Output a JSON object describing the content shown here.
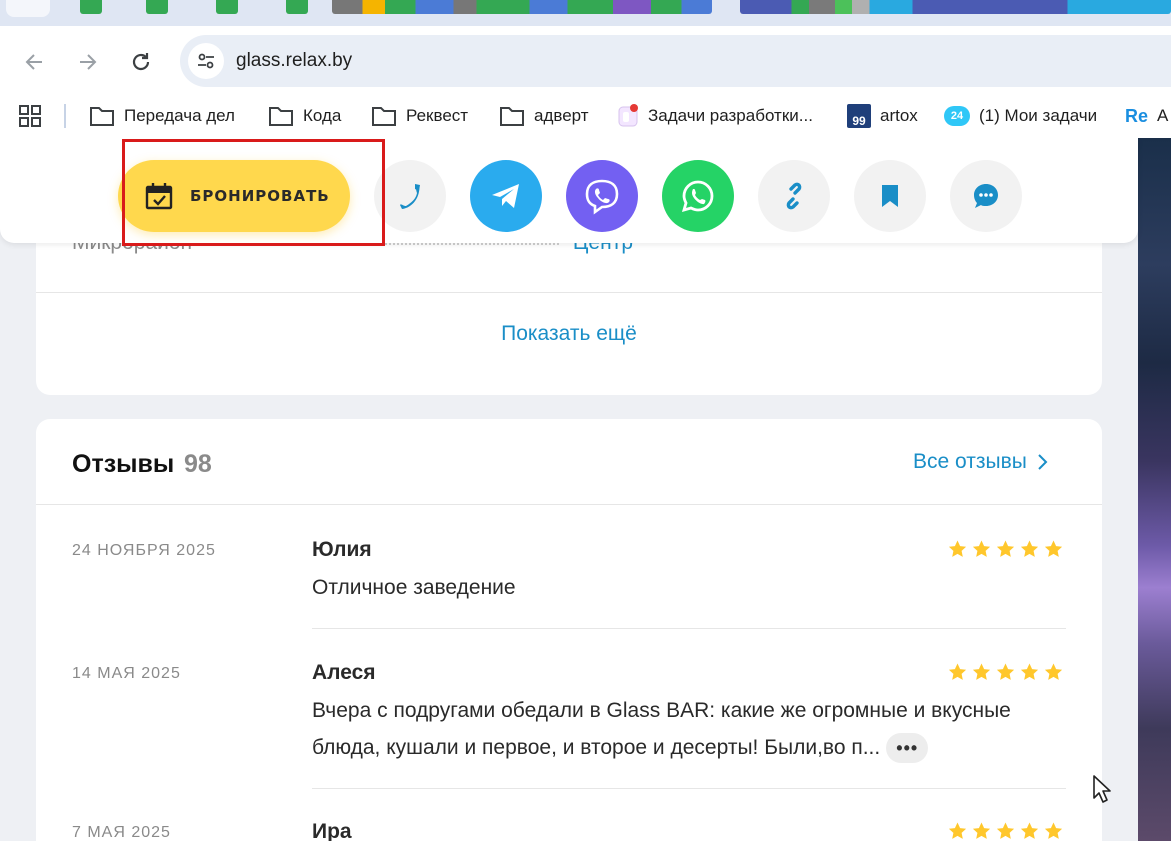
{
  "browser": {
    "url": "glass.relax.by",
    "bookmarks": [
      {
        "label": "Передача дел",
        "icon": "folder-icon"
      },
      {
        "label": "Кода",
        "icon": "folder-icon"
      },
      {
        "label": "Реквест",
        "icon": "folder-icon"
      },
      {
        "label": "адверт",
        "icon": "folder-icon"
      },
      {
        "label": "Задачи разработки...",
        "icon": "app-icon"
      },
      {
        "label": "artox",
        "icon": "99-icon",
        "badge": "99"
      },
      {
        "label": "(1) Мои задачи",
        "icon": "bitrix24-icon",
        "badge": "24"
      },
      {
        "label": "A",
        "icon": "re-icon",
        "badge": "Re"
      }
    ]
  },
  "actions": {
    "book_label": "БРОНИРОВАТЬ",
    "buttons": [
      {
        "name": "phone-button",
        "icon": "phone-icon",
        "color": "#f2f2f2"
      },
      {
        "name": "telegram-button",
        "icon": "telegram-icon",
        "color": "#2aabee"
      },
      {
        "name": "viber-button",
        "icon": "viber-icon",
        "color": "#7360f2"
      },
      {
        "name": "whatsapp-button",
        "icon": "whatsapp-icon",
        "color": "#25d366"
      },
      {
        "name": "share-link-button",
        "icon": "link-icon",
        "color": "#f2f2f2"
      },
      {
        "name": "bookmark-button",
        "icon": "bookmark-icon",
        "color": "#f2f2f2"
      },
      {
        "name": "chat-button",
        "icon": "chat-icon",
        "color": "#f2f2f2"
      }
    ]
  },
  "details": {
    "district_label": "Микрорайон",
    "district_value": "Центр",
    "show_more": "Показать ещё"
  },
  "reviews": {
    "title": "Отзывы",
    "count": "98",
    "all_label": "Все отзывы",
    "items": [
      {
        "date": "24 ноября 2025",
        "author": "Юлия",
        "rating": 5,
        "text": "Отличное заведение"
      },
      {
        "date": "14 мая 2025",
        "author": "Алеся",
        "rating": 5,
        "text": "Вчера с подругами обедали в Glass BAR: какие же огромные и вкусные блюда, кушали и первое, и второе и десерты! Были,во п...",
        "more": "•••"
      },
      {
        "date": "7 мая 2025",
        "author": "Ира",
        "rating": 5,
        "text": ""
      }
    ]
  },
  "colors": {
    "accent": "#1a8ec7",
    "book_button": "#ffd84d",
    "star": "#ffc72c",
    "highlight": "#d91a1a"
  }
}
